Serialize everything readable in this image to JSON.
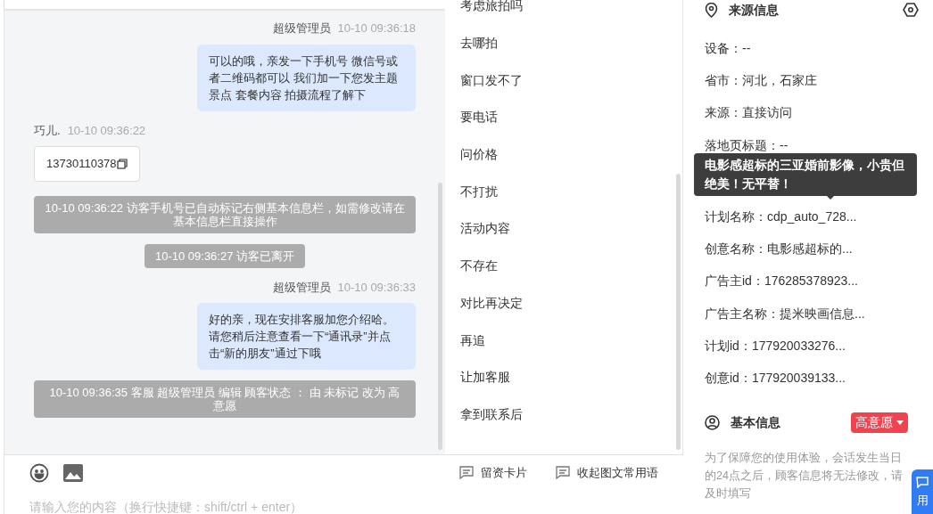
{
  "chat": {
    "messages": [
      {
        "kind": "agent",
        "sender": "超级管理员",
        "time": "10-10 09:36:18",
        "text": "可以的哦，亲发一下手机号 微信号或者二维码都可以 我们加一下您发主题景点 套餐内容 拍摄流程了解下"
      },
      {
        "kind": "visitor",
        "sender": "巧儿.",
        "time": "10-10 09:36:22",
        "text": "13730110378"
      },
      {
        "kind": "system",
        "text": "10-10 09:36:22 访客手机号已自动标记右侧基本信息栏，如需修改请在基本信息栏直接操作"
      },
      {
        "kind": "system",
        "text": "10-10 09:36:27 访客已离开"
      },
      {
        "kind": "agent",
        "sender": "超级管理员",
        "time": "10-10 09:36:33",
        "text": "好的亲，现在安排客服加您介绍哈。请您稍后注意查看一下“通讯录”并点击“新的朋友”通过下哦"
      },
      {
        "kind": "system",
        "text": "10-10 09:36:35 客服 超级管理员 编辑 顾客状态 ： 由 未标记 改为 高意愿"
      }
    ],
    "input": {
      "placeholder": "请输入您的内容（换行快捷键：shift/ctrl + enter）"
    },
    "actions": [
      "留资卡片",
      "收起图文常用语"
    ]
  },
  "phrases": [
    "考虑旅拍吗",
    "去哪拍",
    "窗口发不了",
    "要电话",
    "问价格",
    "不打扰",
    "活动内容",
    "不存在",
    "对比再决定",
    "再追",
    "让加客服",
    "拿到联系后"
  ],
  "source_info": {
    "title": "来源信息",
    "rows": [
      "设备：--",
      "省市：河北，石家庄",
      "来源：直接访问",
      "落地页标题：--",
      "计划名称：cdp_auto_728...",
      "创意名称：电影感超标的...",
      "广告主id：176285378923...",
      "广告主名称：提米映画信息...",
      "计划id：177920033276...",
      "创意id：177920039133..."
    ],
    "tooltip": "电影感超标的三亚婚前影像，小贵但绝美！无平替！"
  },
  "basic_info": {
    "title": "基本信息",
    "status": "高意愿",
    "note": "为了保障您的使用体验，会话发生当日的24点之后，顾客信息将无法修改，请及时填写"
  },
  "float_button": {
    "label": "用"
  }
}
